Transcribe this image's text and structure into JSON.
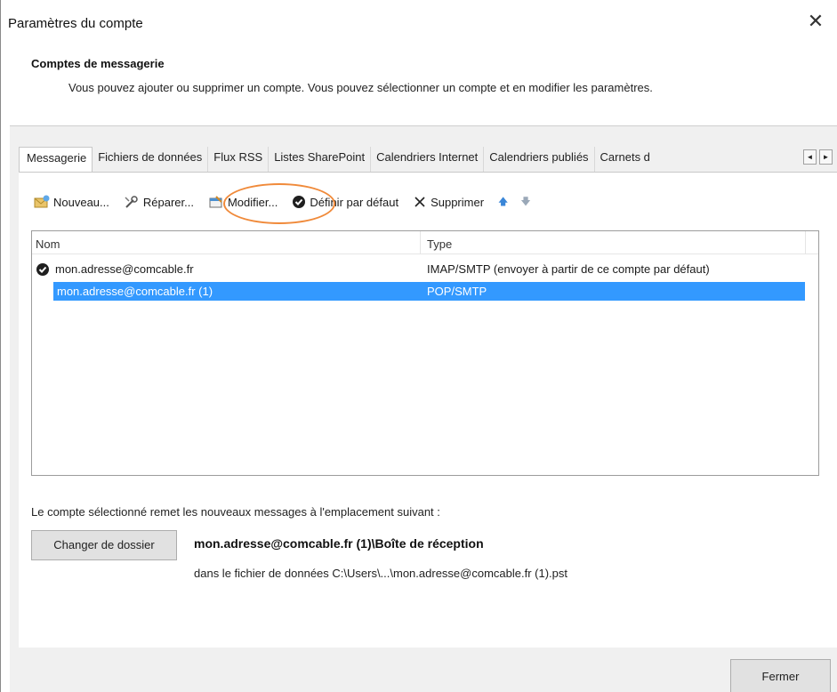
{
  "window": {
    "title": "Paramètres du compte",
    "close_glyph": "✕"
  },
  "header": {
    "title": "Comptes de messagerie",
    "description": "Vous pouvez ajouter ou supprimer un compte. Vous pouvez sélectionner un compte et en modifier les paramètres."
  },
  "tabs": [
    {
      "label": "Messagerie",
      "active": true
    },
    {
      "label": "Fichiers de données"
    },
    {
      "label": "Flux RSS"
    },
    {
      "label": "Listes SharePoint"
    },
    {
      "label": "Calendriers Internet"
    },
    {
      "label": "Calendriers publiés"
    },
    {
      "label": "Carnets d"
    }
  ],
  "tab_scroll": {
    "left": "◄",
    "right": "►"
  },
  "toolbar": {
    "new_label": "Nouveau...",
    "repair_label": "Réparer...",
    "modify_label": "Modifier...",
    "set_default_label": "Définir par défaut",
    "delete_label": "Supprimer",
    "move_up_glyph": "🡅",
    "move_down_glyph": "🡇"
  },
  "accounts_list": {
    "columns": {
      "name": "Nom",
      "type": "Type"
    },
    "rows": [
      {
        "name": "mon.adresse@comcable.fr",
        "type": "IMAP/SMTP (envoyer à partir de ce compte par défaut)",
        "default": true,
        "selected": false
      },
      {
        "name": "mon.adresse@comcable.fr (1)",
        "type": "POP/SMTP",
        "default": false,
        "selected": true
      }
    ]
  },
  "delivery": {
    "label": "Le compte sélectionné remet les nouveaux messages à l'emplacement suivant :",
    "change_folder_label": "Changer de dossier",
    "mailbox_path": "mon.adresse@comcable.fr (1)\\Boîte de réception",
    "data_file": "dans le fichier de données C:\\Users\\...\\mon.adresse@comcable.fr (1).pst"
  },
  "footer": {
    "close_label": "Fermer"
  },
  "colors": {
    "selection": "#3399ff",
    "highlight_ring": "#f08a3a",
    "dialog_gray": "#f0f0f0"
  }
}
